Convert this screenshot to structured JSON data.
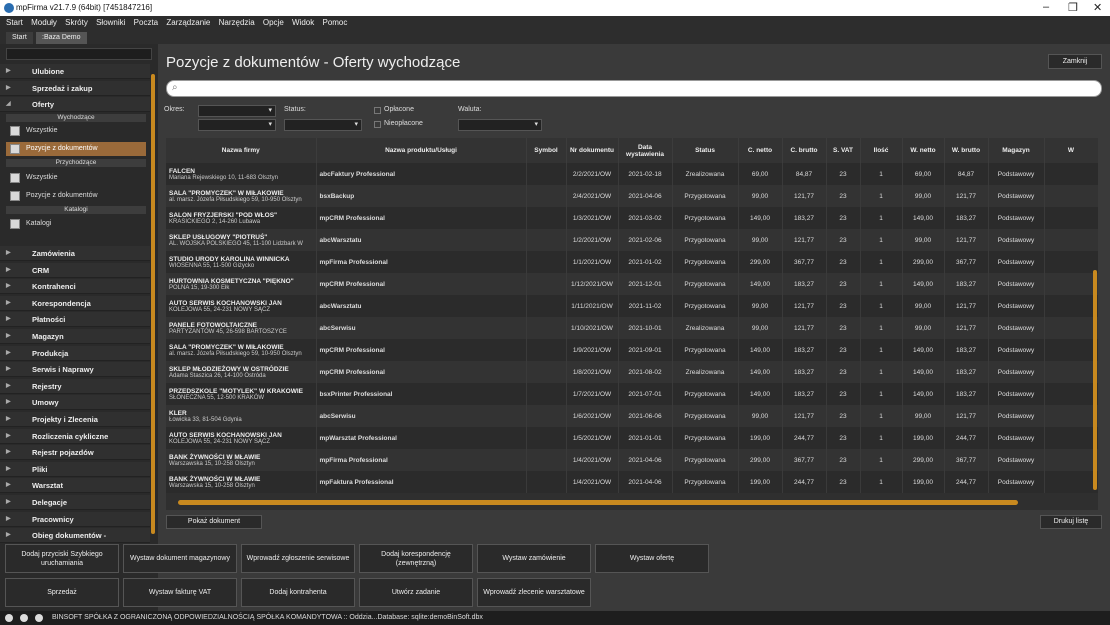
{
  "window": {
    "title": "mpFirma v21.7.9 (64bit) [7451847216]"
  },
  "menu": [
    "Start",
    "Moduły",
    "Skróty",
    "Słowniki",
    "Poczta",
    "Zarządzanie",
    "Narzędzia",
    "Opcje",
    "Widok",
    "Pomoc"
  ],
  "tabs": [
    "Start",
    ":Baza Demo"
  ],
  "sidebar": {
    "ulubione": "Ulubione",
    "sprzedaz": "Sprzedaż i zakup",
    "oferty": "Oferty",
    "wychodzace_hdr": "Wychodzące",
    "wszystkie_1": "Wszystkie",
    "pozycje_1": "Pozycje z dokumentów",
    "przychodzace_hdr": "Przychodzące",
    "wszystkie_2": "Wszystkie",
    "pozycje_2": "Pozycje z dokumentów",
    "katalogi_hdr": "Katalogi",
    "katalogi": "Katalogi",
    "sections": [
      "Zamówienia",
      "CRM",
      "Kontrahenci",
      "Korespondencja",
      "Płatności",
      "Magazyn",
      "Produkcja",
      "Serwis i Naprawy",
      "Rejestry",
      "Umowy",
      "Projekty i Zlecenia",
      "Rozliczenia cykliczne",
      "Rejestr pojazdów",
      "Pliki",
      "Warsztat",
      "Delegacje",
      "Pracownicy",
      "Obieg dokumentów - Księgowość"
    ]
  },
  "main": {
    "title": "Pozycje z dokumentów - Oferty wychodzące",
    "close_label": "Zamknij",
    "search_icon": "search-icon"
  },
  "filters": {
    "okres_label": "Okres:",
    "status_label": "Status:",
    "oplacone_label": "Opłacone",
    "nieoplacone_label": "Nieopłacone",
    "waluta_label": "Waluta:"
  },
  "table": {
    "columns": [
      "Nazwa firmy",
      "Nazwa produktu/Usługi",
      "Symbol",
      "Nr dokumentu",
      "Data wystawienia",
      "Status",
      "C. netto",
      "C. brutto",
      "S. VAT",
      "Ilość",
      "W. netto",
      "W. brutto",
      "Magazyn",
      "W"
    ],
    "rows": [
      [
        "FALCEN",
        "Mariana Rejewskiego 10, 11-683 Olsztyn",
        "abcFaktury Professional",
        "",
        "2/2/2021/OW",
        "2021-02-18",
        "Zrealizowana",
        "69,00",
        "84,87",
        "23",
        "1",
        "69,00",
        "84,87",
        "Podstawowy"
      ],
      [
        "SALA \"PROMYCZEK\" W MIŁAKOWIE",
        "al. marsz. Józefa Piłsudskiego 59, 10-950 Olsztyn",
        "bsxBackup",
        "",
        "2/4/2021/OW",
        "2021-04-06",
        "Przygotowana",
        "99,00",
        "121,77",
        "23",
        "1",
        "99,00",
        "121,77",
        "Podstawowy"
      ],
      [
        "SALON FRYZJERSKI \"POD WŁOS\"",
        "KRASICKIEGO 2, 14-260 Lubawa",
        "mpCRM Professional",
        "",
        "1/3/2021/OW",
        "2021-03-02",
        "Przygotowana",
        "149,00",
        "183,27",
        "23",
        "1",
        "149,00",
        "183,27",
        "Podstawowy"
      ],
      [
        "SKLEP USŁUGOWY \"PIOTRUŚ\"",
        "AL. WOJSKA POLSKIEGO 45, 11-100 Lidzbark W",
        "abcWarsztatu",
        "",
        "1/2/2021/OW",
        "2021-02-06",
        "Przygotowana",
        "99,00",
        "121,77",
        "23",
        "1",
        "99,00",
        "121,77",
        "Podstawowy"
      ],
      [
        "STUDIO URODY KAROLINA WINNICKA",
        "WIOSENNA 55, 11-500 Giżycko",
        "mpFirma Professional",
        "",
        "1/1/2021/OW",
        "2021-01-02",
        "Przygotowana",
        "299,00",
        "367,77",
        "23",
        "1",
        "299,00",
        "367,77",
        "Podstawowy"
      ],
      [
        "HURTOWNIA KOSMETYCZNA \"PIĘKNO\"",
        "POLNA 15, 19-300 Ełk",
        "mpCRM Professional",
        "",
        "1/12/2021/OW",
        "2021-12-01",
        "Przygotowana",
        "149,00",
        "183,27",
        "23",
        "1",
        "149,00",
        "183,27",
        "Podstawowy"
      ],
      [
        "AUTO SERWIS KOCHANOWSKI JAN",
        "KOLEJOWA 55, 24-231 NOWY SĄCZ",
        "abcWarsztatu",
        "",
        "1/11/2021/OW",
        "2021-11-02",
        "Przygotowana",
        "99,00",
        "121,77",
        "23",
        "1",
        "99,00",
        "121,77",
        "Podstawowy"
      ],
      [
        "PANELE FOTOWOLTAICZNE",
        "PARTYZANTÓW 45, 26-598 BARTOSZYCE",
        "abcSerwisu",
        "",
        "1/10/2021/OW",
        "2021-10-01",
        "Zrealizowana",
        "99,00",
        "121,77",
        "23",
        "1",
        "99,00",
        "121,77",
        "Podstawowy"
      ],
      [
        "SALA \"PROMYCZEK\" W MIŁAKOWIE",
        "al. marsz. Józefa Piłsudskiego 59, 10-950 Olsztyn",
        "mpCRM Professional",
        "",
        "1/9/2021/OW",
        "2021-09-01",
        "Przygotowana",
        "149,00",
        "183,27",
        "23",
        "1",
        "149,00",
        "183,27",
        "Podstawowy"
      ],
      [
        "SKLEP MŁODZIEŻOWY W OSTRÓDZIE",
        "Adama Staszica 26, 14-100 Ostróda",
        "mpCRM Professional",
        "",
        "1/8/2021/OW",
        "2021-08-02",
        "Zrealizowana",
        "149,00",
        "183,27",
        "23",
        "1",
        "149,00",
        "183,27",
        "Podstawowy"
      ],
      [
        "PRZEDSZKOLE \"MOTYLEK\" W KRAKOWIE",
        "SŁONECZNA 55, 12-500 KRAKÓW",
        "bsxPrinter Professional",
        "",
        "1/7/2021/OW",
        "2021-07-01",
        "Przygotowana",
        "149,00",
        "183,27",
        "23",
        "1",
        "149,00",
        "183,27",
        "Podstawowy"
      ],
      [
        "KLER",
        "Łowicka 33, 81-504 Gdynia",
        "abcSerwisu",
        "",
        "1/6/2021/OW",
        "2021-06-06",
        "Przygotowana",
        "99,00",
        "121,77",
        "23",
        "1",
        "99,00",
        "121,77",
        "Podstawowy"
      ],
      [
        "AUTO SERWIS KOCHANOWSKI JAN",
        "KOLEJOWA 55, 24-231 NOWY SĄCZ",
        "mpWarsztat Professional",
        "",
        "1/5/2021/OW",
        "2021-01-01",
        "Przygotowana",
        "199,00",
        "244,77",
        "23",
        "1",
        "199,00",
        "244,77",
        "Podstawowy"
      ],
      [
        "BANK ŻYWNOŚCI W MŁAWIE",
        "Warszawska 15, 10-258 Olsztyn",
        "mpFirma Professional",
        "",
        "1/4/2021/OW",
        "2021-04-06",
        "Przygotowana",
        "299,00",
        "367,77",
        "23",
        "1",
        "299,00",
        "367,77",
        "Podstawowy"
      ],
      [
        "BANK ŻYWNOŚCI W MŁAWIE",
        "Warszawska 15, 10-258 Olsztyn",
        "mpFaktura Professional",
        "",
        "1/4/2021/OW",
        "2021-04-06",
        "Przygotowana",
        "199,00",
        "244,77",
        "23",
        "1",
        "199,00",
        "244,77",
        "Podstawowy"
      ]
    ]
  },
  "actions": {
    "pokaz_dokument": "Pokaż dokument",
    "drukuj_liste": "Drukuj listę"
  },
  "quick": [
    "Dodaj przyciski Szybkiego uruchamiania",
    "Wystaw dokument magazynowy",
    "Wprowadź zgłoszenie serwisowe",
    "Dodaj korespondencję (zewnętrzną)",
    "Wystaw zamówienie",
    "Wystaw ofertę",
    "Sprzedaż",
    "Wystaw fakturę VAT",
    "Dodaj kontrahenta",
    "Utwórz zadanie",
    "Wprowadź zlecenie warsztatowe"
  ],
  "status": {
    "text": "BINSOFT SPÓŁKA Z OGRANICZONĄ ODPOWIEDZIALNOŚCIĄ SPÓŁKA KOMANDYTOWA :: Oddzia...Database: sqlite:demoBinSoft.dbx"
  },
  "colors": {
    "accent": "#c8891f",
    "active_item": "#9a6a3a",
    "background": "#3a3a3a"
  }
}
